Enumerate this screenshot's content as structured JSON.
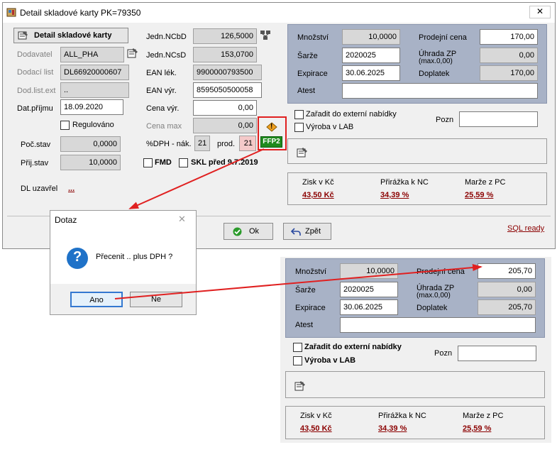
{
  "window": {
    "title": "Detail skladové karty PK=79350",
    "close_symbol": "✕"
  },
  "left": {
    "header_button": "Detail skladové karty",
    "dodavatel_label": "Dodavatel",
    "dodavatel_value": "ALL_PHA",
    "dodaci_list_label": "Dodací list",
    "dodaci_list_value": "DL66920000607",
    "dod_list_ext_label": "Dod.list.ext",
    "dod_list_ext_value": "..",
    "dat_prijmu_label": "Dat.příjmu",
    "dat_prijmu_value": "18.09.2020",
    "regulovano_label": "Regulováno",
    "poc_stav_label": "Poč.stav",
    "poc_stav_value": "0,0000",
    "prij_stav_label": "Přij.stav",
    "prij_stav_value": "10,0000",
    "dl_uzavrel_label": "DL uzavřel",
    "dl_uzavrel_value": "..."
  },
  "middle": {
    "jedn_ncbd_label": "Jedn.NCbD",
    "jedn_ncbd_value": "126,5000",
    "jedn_ncsd_label": "Jedn.NCsD",
    "jedn_ncsd_value": "153,0700",
    "ean_lek_label": "EAN lék.",
    "ean_lek_value": "9900000793500",
    "ean_vyr_label": "EAN výr.",
    "ean_vyr_value": "8595050500058",
    "cena_vyr_label": "Cena výr.",
    "cena_vyr_value": "0,00",
    "cena_max_label": "Cena max",
    "cena_max_value": "0,00",
    "dph_label": "%DPH - nák.",
    "dph_nak_value": "21",
    "prod_label": "prod.",
    "dph_prod_value": "21",
    "ffp2_label": "FFP2",
    "warning_symbol": "!",
    "fmd_label": "FMD",
    "skl_label": "SKL před 9.7.2019"
  },
  "right_top": {
    "mnozstvi_label": "Množství",
    "mnozstvi_value": "10,0000",
    "prodejni_cena_label": "Prodejní cena",
    "prodejni_cena_value": "170,00",
    "sarze_label": "Šarže",
    "sarze_value": "2020025",
    "uhrada_label": "Úhrada ZP",
    "uhrada_sub": "(max.0,00)",
    "uhrada_value": "0,00",
    "expirace_label": "Expirace",
    "expirace_value": "30.06.2025",
    "doplatek_label": "Doplatek",
    "doplatek_value": "170,00",
    "atest_label": "Atest",
    "zaradit_label": "Zařadit do externí nabídky",
    "vyroba_label": "Výroba v LAB",
    "pozn_label": "Pozn",
    "zisk_label": "Zisk v Kč",
    "zisk_value": "43,50 Kč",
    "prirazka_label": "Přirážka k NC",
    "prirazka_value": "34,39 %",
    "marze_label": "Marže z PC",
    "marze_value": "25,59 %"
  },
  "footer": {
    "ok_label": "Ok",
    "zpet_label": "Zpět",
    "sql_ready": "SQL ready"
  },
  "dialog": {
    "title": "Dotaz",
    "close_symbol": "✕",
    "icon_symbol": "?",
    "message": "Přecenit .. plus DPH ?",
    "yes_label": "Ano",
    "no_label": "Ne"
  },
  "bottom": {
    "mnozstvi_label": "Množství",
    "mnozstvi_value": "10,0000",
    "prodejni_cena_label": "Prodejní cena",
    "prodejni_cena_value": "205,70",
    "sarze_label": "Šarže",
    "sarze_value": "2020025",
    "uhrada_label": "Úhrada ZP",
    "uhrada_sub": "(max.0,00)",
    "uhrada_value": "0,00",
    "expirace_label": "Expirace",
    "expirace_value": "30.06.2025",
    "doplatek_label": "Doplatek",
    "doplatek_value": "205,70",
    "atest_label": "Atest",
    "zaradit_label": "Zařadit do externí nabídky",
    "vyroba_label": "Výroba v LAB",
    "pozn_label": "Pozn",
    "zisk_label": "Zisk v Kč",
    "zisk_value": "43,50 Kč",
    "prirazka_label": "Přirážka k NC",
    "prirazka_value": "34,39 %",
    "marze_label": "Marže z PC",
    "marze_value": "25,59 %"
  },
  "colors": {
    "accent_blue_panel": "#a8b2c6",
    "highlight_red": "#e02020",
    "link_dark_red": "#8b0000",
    "ffp2_green": "#1e8a1e"
  }
}
